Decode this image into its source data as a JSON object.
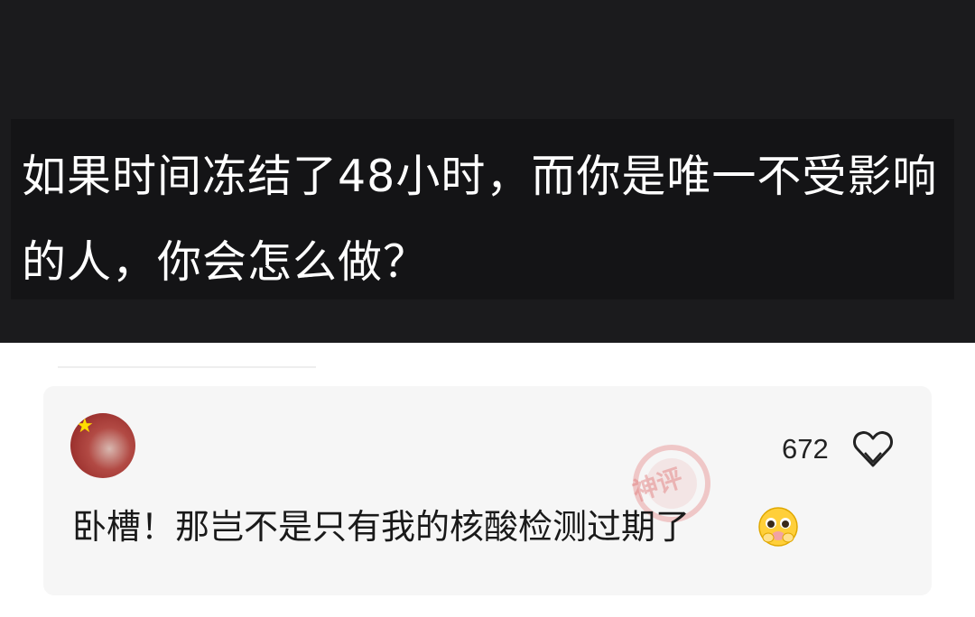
{
  "question": {
    "text": "如果时间冻结了48小时，而你是唯一不受影响的人，你会怎么做？"
  },
  "comment": {
    "avatar_icon": "user-avatar-icon",
    "like_count": "672",
    "like_icon": "heart-icon",
    "stamp_text": "神评",
    "text": "卧槽！那岂不是只有我的核酸检测过期了",
    "emoji_icon": "pleading-face-icon"
  },
  "colors": {
    "top_background": "#1b1b1d",
    "question_text": "#ffffff",
    "card_background": "#f6f6f6",
    "stamp": "#e07878"
  }
}
